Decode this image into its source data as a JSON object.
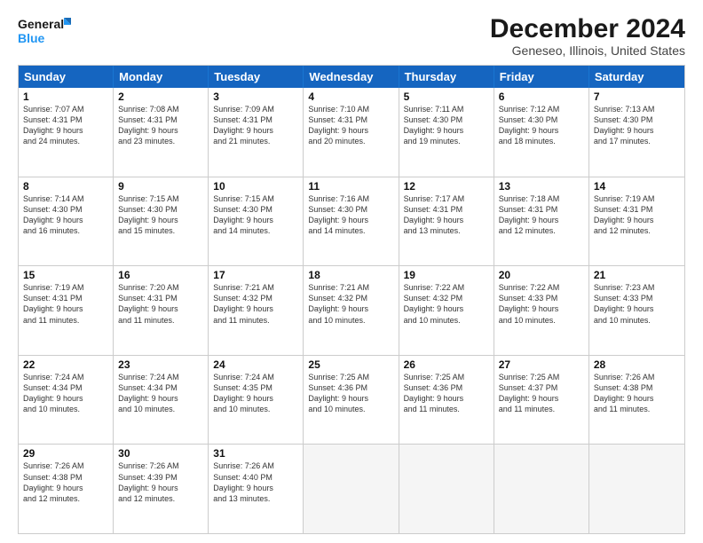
{
  "logo": {
    "line1": "General",
    "line2": "Blue"
  },
  "title": "December 2024",
  "subtitle": "Geneseo, Illinois, United States",
  "headers": [
    "Sunday",
    "Monday",
    "Tuesday",
    "Wednesday",
    "Thursday",
    "Friday",
    "Saturday"
  ],
  "weeks": [
    [
      {
        "day": "1",
        "info": "Sunrise: 7:07 AM\nSunset: 4:31 PM\nDaylight: 9 hours\nand 24 minutes."
      },
      {
        "day": "2",
        "info": "Sunrise: 7:08 AM\nSunset: 4:31 PM\nDaylight: 9 hours\nand 23 minutes."
      },
      {
        "day": "3",
        "info": "Sunrise: 7:09 AM\nSunset: 4:31 PM\nDaylight: 9 hours\nand 21 minutes."
      },
      {
        "day": "4",
        "info": "Sunrise: 7:10 AM\nSunset: 4:31 PM\nDaylight: 9 hours\nand 20 minutes."
      },
      {
        "day": "5",
        "info": "Sunrise: 7:11 AM\nSunset: 4:30 PM\nDaylight: 9 hours\nand 19 minutes."
      },
      {
        "day": "6",
        "info": "Sunrise: 7:12 AM\nSunset: 4:30 PM\nDaylight: 9 hours\nand 18 minutes."
      },
      {
        "day": "7",
        "info": "Sunrise: 7:13 AM\nSunset: 4:30 PM\nDaylight: 9 hours\nand 17 minutes."
      }
    ],
    [
      {
        "day": "8",
        "info": "Sunrise: 7:14 AM\nSunset: 4:30 PM\nDaylight: 9 hours\nand 16 minutes."
      },
      {
        "day": "9",
        "info": "Sunrise: 7:15 AM\nSunset: 4:30 PM\nDaylight: 9 hours\nand 15 minutes."
      },
      {
        "day": "10",
        "info": "Sunrise: 7:15 AM\nSunset: 4:30 PM\nDaylight: 9 hours\nand 14 minutes."
      },
      {
        "day": "11",
        "info": "Sunrise: 7:16 AM\nSunset: 4:30 PM\nDaylight: 9 hours\nand 14 minutes."
      },
      {
        "day": "12",
        "info": "Sunrise: 7:17 AM\nSunset: 4:31 PM\nDaylight: 9 hours\nand 13 minutes."
      },
      {
        "day": "13",
        "info": "Sunrise: 7:18 AM\nSunset: 4:31 PM\nDaylight: 9 hours\nand 12 minutes."
      },
      {
        "day": "14",
        "info": "Sunrise: 7:19 AM\nSunset: 4:31 PM\nDaylight: 9 hours\nand 12 minutes."
      }
    ],
    [
      {
        "day": "15",
        "info": "Sunrise: 7:19 AM\nSunset: 4:31 PM\nDaylight: 9 hours\nand 11 minutes."
      },
      {
        "day": "16",
        "info": "Sunrise: 7:20 AM\nSunset: 4:31 PM\nDaylight: 9 hours\nand 11 minutes."
      },
      {
        "day": "17",
        "info": "Sunrise: 7:21 AM\nSunset: 4:32 PM\nDaylight: 9 hours\nand 11 minutes."
      },
      {
        "day": "18",
        "info": "Sunrise: 7:21 AM\nSunset: 4:32 PM\nDaylight: 9 hours\nand 10 minutes."
      },
      {
        "day": "19",
        "info": "Sunrise: 7:22 AM\nSunset: 4:32 PM\nDaylight: 9 hours\nand 10 minutes."
      },
      {
        "day": "20",
        "info": "Sunrise: 7:22 AM\nSunset: 4:33 PM\nDaylight: 9 hours\nand 10 minutes."
      },
      {
        "day": "21",
        "info": "Sunrise: 7:23 AM\nSunset: 4:33 PM\nDaylight: 9 hours\nand 10 minutes."
      }
    ],
    [
      {
        "day": "22",
        "info": "Sunrise: 7:24 AM\nSunset: 4:34 PM\nDaylight: 9 hours\nand 10 minutes."
      },
      {
        "day": "23",
        "info": "Sunrise: 7:24 AM\nSunset: 4:34 PM\nDaylight: 9 hours\nand 10 minutes."
      },
      {
        "day": "24",
        "info": "Sunrise: 7:24 AM\nSunset: 4:35 PM\nDaylight: 9 hours\nand 10 minutes."
      },
      {
        "day": "25",
        "info": "Sunrise: 7:25 AM\nSunset: 4:36 PM\nDaylight: 9 hours\nand 10 minutes."
      },
      {
        "day": "26",
        "info": "Sunrise: 7:25 AM\nSunset: 4:36 PM\nDaylight: 9 hours\nand 11 minutes."
      },
      {
        "day": "27",
        "info": "Sunrise: 7:25 AM\nSunset: 4:37 PM\nDaylight: 9 hours\nand 11 minutes."
      },
      {
        "day": "28",
        "info": "Sunrise: 7:26 AM\nSunset: 4:38 PM\nDaylight: 9 hours\nand 11 minutes."
      }
    ],
    [
      {
        "day": "29",
        "info": "Sunrise: 7:26 AM\nSunset: 4:38 PM\nDaylight: 9 hours\nand 12 minutes."
      },
      {
        "day": "30",
        "info": "Sunrise: 7:26 AM\nSunset: 4:39 PM\nDaylight: 9 hours\nand 12 minutes."
      },
      {
        "day": "31",
        "info": "Sunrise: 7:26 AM\nSunset: 4:40 PM\nDaylight: 9 hours\nand 13 minutes."
      },
      {
        "day": "",
        "info": ""
      },
      {
        "day": "",
        "info": ""
      },
      {
        "day": "",
        "info": ""
      },
      {
        "day": "",
        "info": ""
      }
    ]
  ]
}
